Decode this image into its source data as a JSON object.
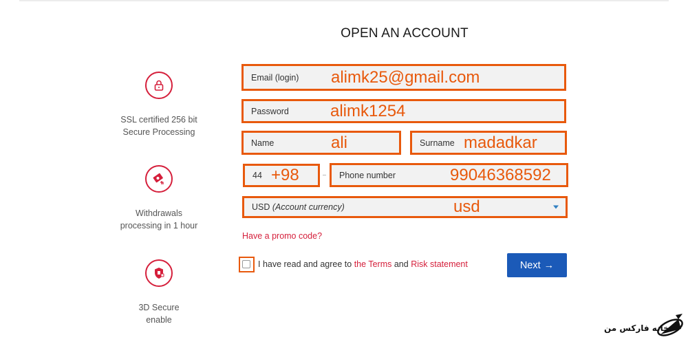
{
  "page": {
    "title": "OPEN AN ACCOUNT"
  },
  "features": [
    {
      "icon": "lock-icon",
      "text_line1": "SSL certified 256 bit",
      "text_line2": "Secure Processing"
    },
    {
      "icon": "money-withdrawal-icon",
      "text_line1": "Withdrawals",
      "text_line2": "processing in 1 hour"
    },
    {
      "icon": "secure-shield-icon",
      "text_line1": "3D Secure",
      "text_line2": "enable"
    }
  ],
  "form": {
    "email": {
      "label": "Email (login)",
      "value": "alimk25@gmail.com"
    },
    "password": {
      "label": "Password",
      "value": "alimk1254"
    },
    "name": {
      "label": "Name",
      "value": "ali"
    },
    "surname": {
      "label": "Surname",
      "value": "madadkar"
    },
    "phone_code": {
      "label": "44",
      "value": "+98"
    },
    "phone": {
      "label": "Phone number",
      "value": "99046368592"
    },
    "currency": {
      "label": "USD",
      "label_italic": "(Account currency)",
      "value": "usd"
    }
  },
  "promo_link": "Have a promo code?",
  "agreement": {
    "prefix": "I have read and agree to",
    "terms_link": "the Terms",
    "and": "and",
    "risk_link": "Risk statement",
    "checked": false
  },
  "next_button": {
    "label": "Next",
    "arrow": "→"
  },
  "watermark": {
    "text": "خانه فارکس من"
  },
  "colors": {
    "accent_red": "#d51f3b",
    "highlight_orange": "#e8590c",
    "button_blue": "#1b5ab8",
    "field_bg": "#f2f2f2"
  }
}
